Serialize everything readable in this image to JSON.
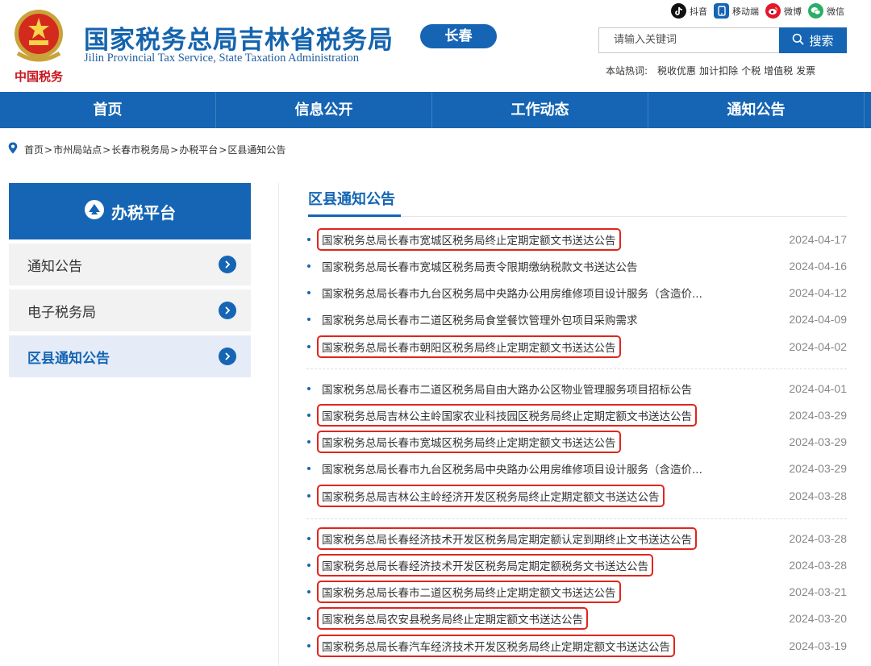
{
  "header": {
    "site_title": "国家税务总局吉林省税务局",
    "site_subtitle": "Jilin Provincial Tax Service, State Taxation Administration",
    "city_badge": "长春",
    "emblem_caption": "中国税务",
    "search_placeholder": "请输入关键词",
    "search_button": "搜索",
    "social": [
      {
        "label": "抖音",
        "icon": "douyin-icon",
        "color": "#111111"
      },
      {
        "label": "移动端",
        "icon": "mobile-icon",
        "color": "#1565b4"
      },
      {
        "label": "微博",
        "icon": "weibo-icon",
        "color": "#e6162d"
      },
      {
        "label": "微信",
        "icon": "wechat-icon",
        "color": "#2aae67"
      }
    ],
    "hotwords_label": "本站热词:",
    "hotwords": [
      "税收优惠",
      "加计扣除",
      "个税",
      "增值税",
      "发票"
    ]
  },
  "nav": [
    "首页",
    "信息公开",
    "工作动态",
    "通知公告"
  ],
  "breadcrumb": [
    "首页",
    "市州局站点",
    "长春市税务局",
    "办税平台",
    "区县通知公告"
  ],
  "sidebar": {
    "title": "办税平台",
    "items": [
      "通知公告",
      "电子税务局",
      "区县通知公告"
    ]
  },
  "main": {
    "title": "区县通知公告",
    "groups": [
      [
        {
          "title": "国家税务总局长春市宽城区税务局终止定期定额文书送达公告",
          "date": "2024-04-17",
          "boxed": true
        },
        {
          "title": "国家税务总局长春市宽城区税务局责令限期缴纳税款文书送达公告",
          "date": "2024-04-16",
          "boxed": false
        },
        {
          "title": "国家税务总局长春市九台区税务局中央路办公用房维修项目设计服务（含造价...",
          "date": "2024-04-12",
          "boxed": false
        },
        {
          "title": "国家税务总局长春市二道区税务局食堂餐饮管理外包项目采购需求",
          "date": "2024-04-09",
          "boxed": false
        },
        {
          "title": "国家税务总局长春市朝阳区税务局终止定期定额文书送达公告",
          "date": "2024-04-02",
          "boxed": true
        }
      ],
      [
        {
          "title": "国家税务总局长春市二道区税务局自由大路办公区物业管理服务项目招标公告",
          "date": "2024-04-01",
          "boxed": false
        },
        {
          "title": "国家税务总局吉林公主岭国家农业科技园区税务局终止定期定额文书送达公告",
          "date": "2024-03-29",
          "boxed": true
        },
        {
          "title": "国家税务总局长春市宽城区税务局终止定期定额文书送达公告",
          "date": "2024-03-29",
          "boxed": true
        },
        {
          "title": "国家税务总局长春市九台区税务局中央路办公用房维修项目设计服务（含造价...",
          "date": "2024-03-29",
          "boxed": false
        },
        {
          "title": "国家税务总局吉林公主岭经济开发区税务局终止定期定额文书送达公告",
          "date": "2024-03-28",
          "boxed": true
        }
      ],
      [
        {
          "title": "国家税务总局长春经济技术开发区税务局定期定额认定到期终止文书送达公告",
          "date": "2024-03-28",
          "boxed": true
        },
        {
          "title": "国家税务总局长春经济技术开发区税务局定期定额税务文书送达公告",
          "date": "2024-03-28",
          "boxed": true
        },
        {
          "title": "国家税务总局长春市二道区税务局终止定期定额文书送达公告",
          "date": "2024-03-21",
          "boxed": true
        },
        {
          "title": "国家税务总局农安县税务局终止定期定额文书送达公告",
          "date": "2024-03-20",
          "boxed": true
        },
        {
          "title": "国家税务总局长春汽车经济技术开发区税务局终止定期定额文书送达公告",
          "date": "2024-03-19",
          "boxed": true
        }
      ]
    ]
  },
  "colors": {
    "brand": "#1565b4",
    "highlight": "#e1251b"
  }
}
